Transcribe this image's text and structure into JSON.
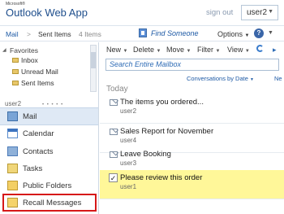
{
  "header": {
    "ms_label": "Microsoft®",
    "app_title": "Outlook Web App",
    "sign_out": "sign out",
    "user": "user2"
  },
  "breadcrumb": {
    "mail": "Mail",
    "separator": ">",
    "folder": "Sent Items",
    "count": "4 Items"
  },
  "topbar": {
    "find_someone": "Find Someone",
    "options": "Options",
    "help": "?"
  },
  "favorites": {
    "title": "Favorites",
    "items": [
      "Inbox",
      "Unread Mail",
      "Sent Items"
    ]
  },
  "mailbox_owner": "user2",
  "nav": [
    "Mail",
    "Calendar",
    "Contacts",
    "Tasks",
    "Public Folders",
    "Recall Messages"
  ],
  "toolbar": {
    "new": "New",
    "delete": "Delete",
    "move": "Move",
    "filter": "Filter",
    "view": "View"
  },
  "search": {
    "placeholder": "Search Entire Mailbox"
  },
  "sort": {
    "label": "Conversations by Date",
    "next": "Ne"
  },
  "group": "Today",
  "messages": [
    {
      "subject": "The items you ordered...",
      "from": "user2"
    },
    {
      "subject": "Sales Report for November",
      "from": "user4"
    },
    {
      "subject": "Leave Booking",
      "from": "user3"
    },
    {
      "subject": "Please review this order",
      "from": "user1"
    }
  ],
  "colors": {
    "accent": "#1e5aa5",
    "selection": "#fff799",
    "highlight_box": "#d61818"
  }
}
